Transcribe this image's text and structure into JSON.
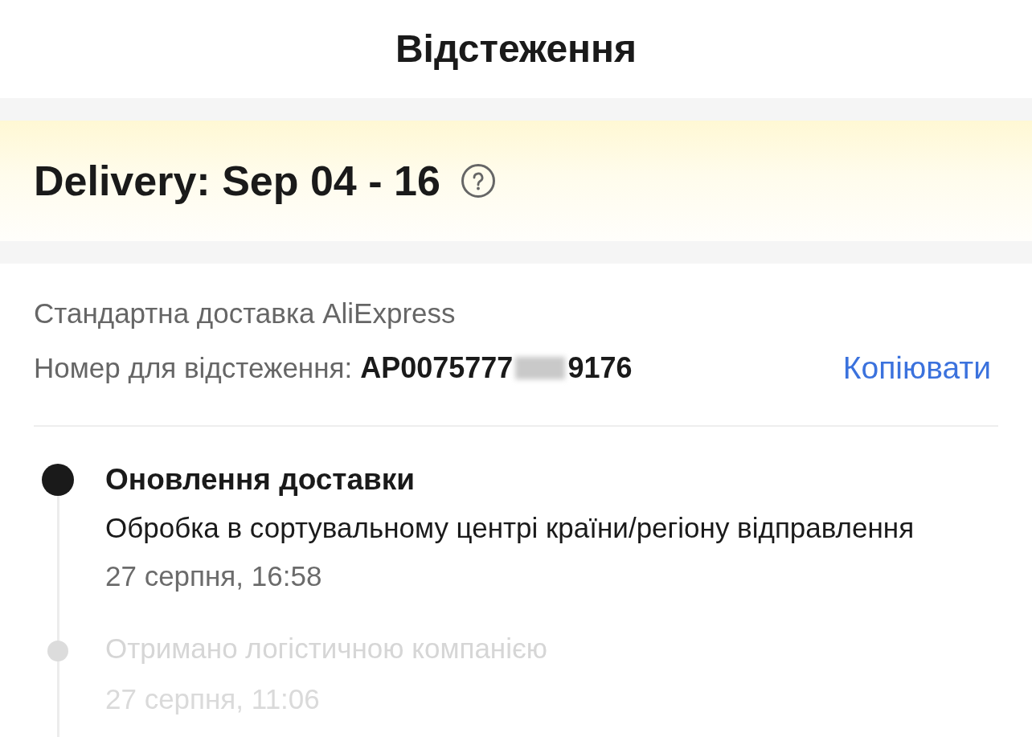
{
  "header": {
    "title": "Відстеження"
  },
  "delivery_banner": {
    "estimate": "Delivery: Sep 04 - 16"
  },
  "shipping": {
    "method": "Стандартна доставка AliExpress",
    "tracking_label": "Номер для відстеження:",
    "tracking_number_start": "AP0075777",
    "tracking_number_redacted": true,
    "tracking_number_end": "9176",
    "copy_button": "Копіювати"
  },
  "timeline": [
    {
      "heading": "Оновлення доставки",
      "description": "Обробка в сортувальному центрі країни/регіону відправлення",
      "time": "27 серпня, 16:58",
      "current": true
    },
    {
      "description": "Отримано логістичною компанією",
      "time": "27 серпня, 11:06",
      "current": false
    }
  ]
}
